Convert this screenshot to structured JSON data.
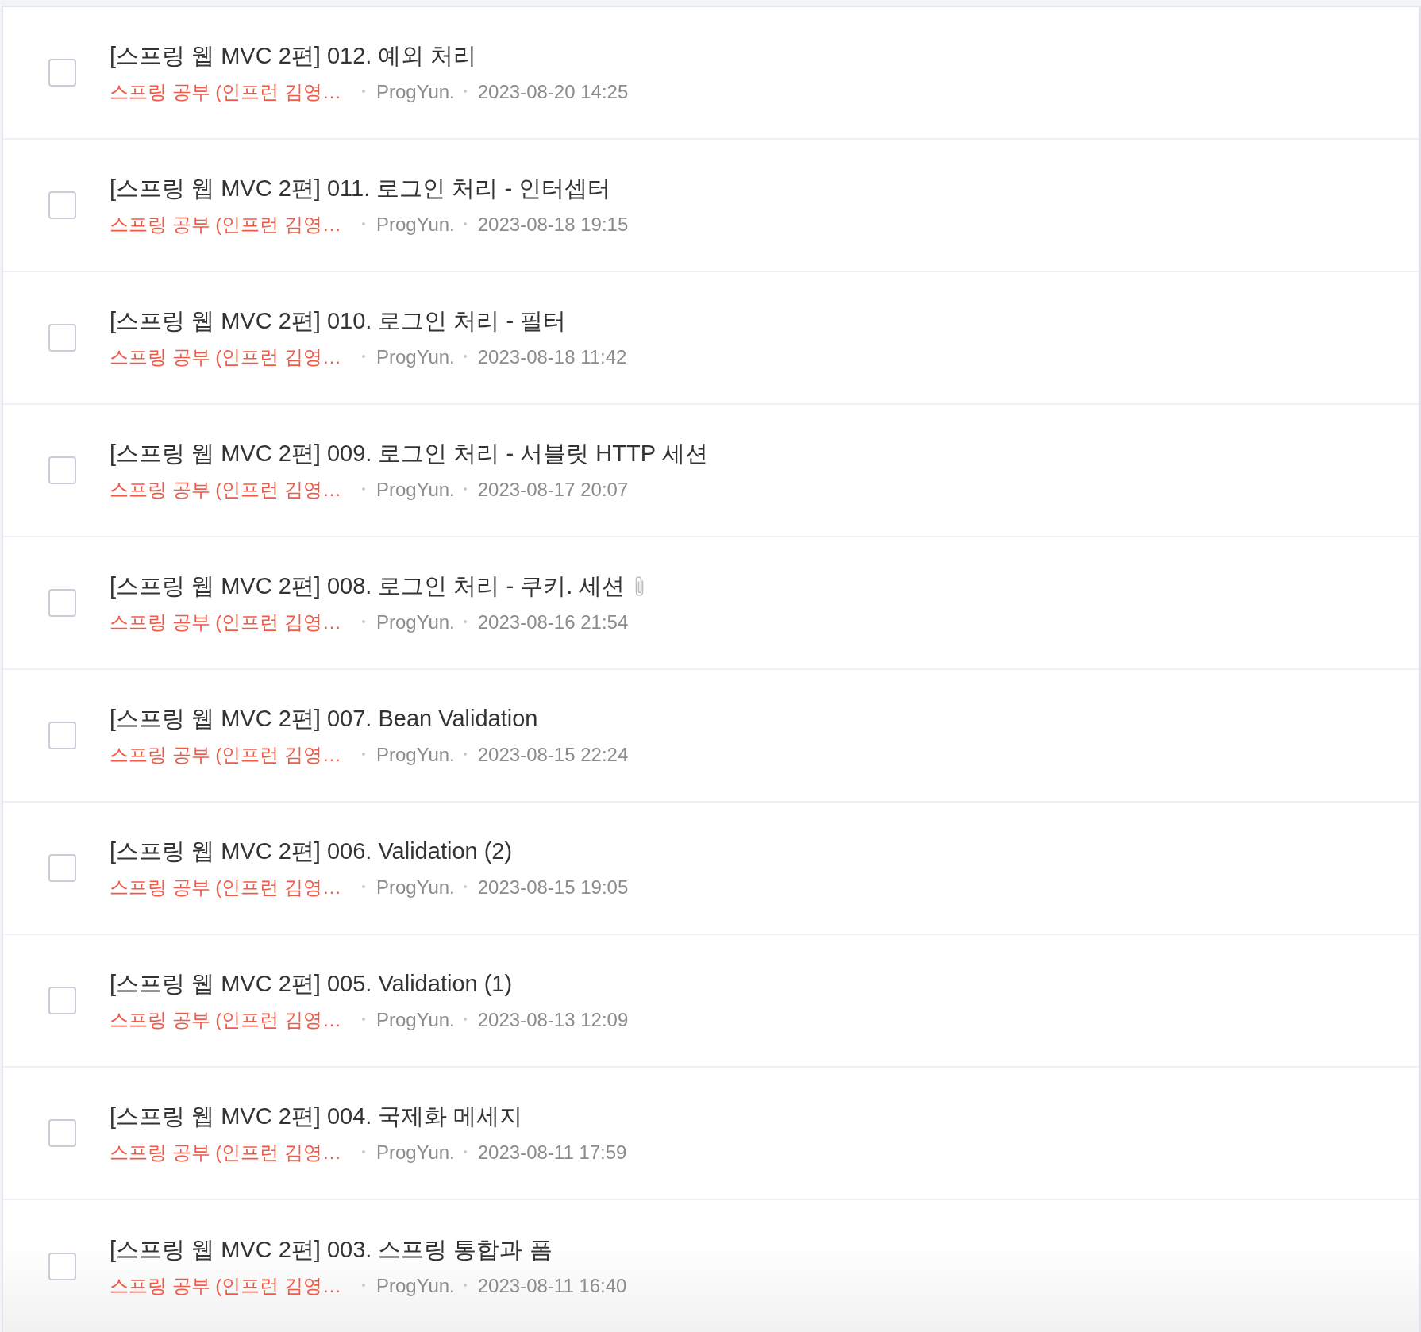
{
  "posts": [
    {
      "title": "[스프링 웹 MVC 2편] 012. 예외 처리",
      "category": "스프링 공부 (인프런 김영…",
      "author": "ProgYun.",
      "date": "2023-08-20 14:25",
      "checked": false,
      "attachment": false
    },
    {
      "title": "[스프링 웹 MVC 2편] 011. 로그인 처리 - 인터셉터",
      "category": "스프링 공부 (인프런 김영…",
      "author": "ProgYun.",
      "date": "2023-08-18 19:15",
      "checked": false,
      "attachment": false
    },
    {
      "title": "[스프링 웹 MVC 2편] 010. 로그인 처리 - 필터",
      "category": "스프링 공부 (인프런 김영…",
      "author": "ProgYun.",
      "date": "2023-08-18 11:42",
      "checked": false,
      "attachment": false
    },
    {
      "title": "[스프링 웹 MVC 2편] 009. 로그인 처리 - 서블릿 HTTP 세션",
      "category": "스프링 공부 (인프런 김영…",
      "author": "ProgYun.",
      "date": "2023-08-17 20:07",
      "checked": false,
      "attachment": false
    },
    {
      "title": "[스프링 웹 MVC 2편] 008. 로그인 처리 - 쿠키. 세션",
      "category": "스프링 공부 (인프런 김영…",
      "author": "ProgYun.",
      "date": "2023-08-16 21:54",
      "checked": false,
      "attachment": true
    },
    {
      "title": "[스프링 웹 MVC 2편] 007. Bean Validation",
      "category": "스프링 공부 (인프런 김영…",
      "author": "ProgYun.",
      "date": "2023-08-15 22:24",
      "checked": false,
      "attachment": false
    },
    {
      "title": "[스프링 웹 MVC 2편] 006. Validation (2)",
      "category": "스프링 공부 (인프런 김영…",
      "author": "ProgYun.",
      "date": "2023-08-15 19:05",
      "checked": false,
      "attachment": false
    },
    {
      "title": "[스프링 웹 MVC 2편] 005. Validation (1)",
      "category": "스프링 공부 (인프런 김영…",
      "author": "ProgYun.",
      "date": "2023-08-13 12:09",
      "checked": false,
      "attachment": false
    },
    {
      "title": "[스프링 웹 MVC 2편] 004. 국제화 메세지",
      "category": "스프링 공부 (인프런 김영…",
      "author": "ProgYun.",
      "date": "2023-08-11 17:59",
      "checked": false,
      "attachment": false
    },
    {
      "title": "[스프링 웹 MVC 2편] 003. 스프링 통합과 폼",
      "category": "스프링 공부 (인프런 김영…",
      "author": "ProgYun.",
      "date": "2023-08-11 16:40",
      "checked": false,
      "attachment": false
    }
  ]
}
